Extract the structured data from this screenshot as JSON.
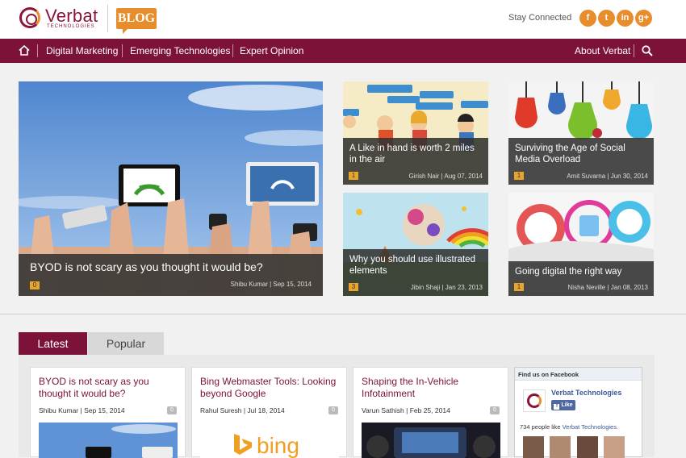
{
  "header": {
    "logo_text": "Verbat",
    "logo_sub": "TECHNOLOGIES",
    "blog_label": "BLOG",
    "stay_connected": "Stay Connected",
    "social": [
      {
        "name": "facebook-icon",
        "glyph": "f"
      },
      {
        "name": "twitter-icon",
        "glyph": "t"
      },
      {
        "name": "linkedin-icon",
        "glyph": "in"
      },
      {
        "name": "googleplus-icon",
        "glyph": "g+"
      }
    ]
  },
  "nav": {
    "items": [
      "Digital Marketing",
      "Emerging Technologies",
      "Expert Opinion"
    ],
    "about": "About Verbat"
  },
  "featured": {
    "main": {
      "title": "BYOD is not scary as you thought it would be?",
      "count": "0",
      "meta": "Shibu Kumar | Sep 15, 2014"
    },
    "tiles": [
      {
        "title": "A Like in hand is worth 2 miles in the air",
        "count": "1",
        "meta": "Girish Nair | Aug 07, 2014"
      },
      {
        "title": "Surviving the Age of Social Media Overload",
        "count": "1",
        "meta": "Amit Suvarna | Jun 30, 2014"
      },
      {
        "title": "Why you should use illustrated elements",
        "count": "3",
        "meta": "Jibin Shaji | Jan 23, 2013"
      },
      {
        "title": "Going digital the right way",
        "count": "1",
        "meta": "Nisha Neville | Jan 08, 2013"
      }
    ]
  },
  "tabs": {
    "latest": "Latest",
    "popular": "Popular"
  },
  "cards": [
    {
      "title": "BYOD is not scary as you thought it would be?",
      "meta": "Shibu Kumar | Sep 15, 2014",
      "count": "0"
    },
    {
      "title": "Bing Webmaster Tools: Looking beyond Google",
      "meta": "Rahul Suresh | Jul 18, 2014",
      "count": "0",
      "image_text": "bing"
    },
    {
      "title": "Shaping the In-Vehicle Infotainment",
      "meta": "Varun Sathish | Feb 25, 2014",
      "count": "0"
    }
  ],
  "facebook": {
    "header": "Find us on Facebook",
    "page_name": "Verbat Technologies",
    "like": "Like",
    "people_count": "734 people like",
    "people_page": "Verbat Technologies."
  },
  "colors": {
    "brand": "#7c1239",
    "accent": "#e88d2c"
  }
}
